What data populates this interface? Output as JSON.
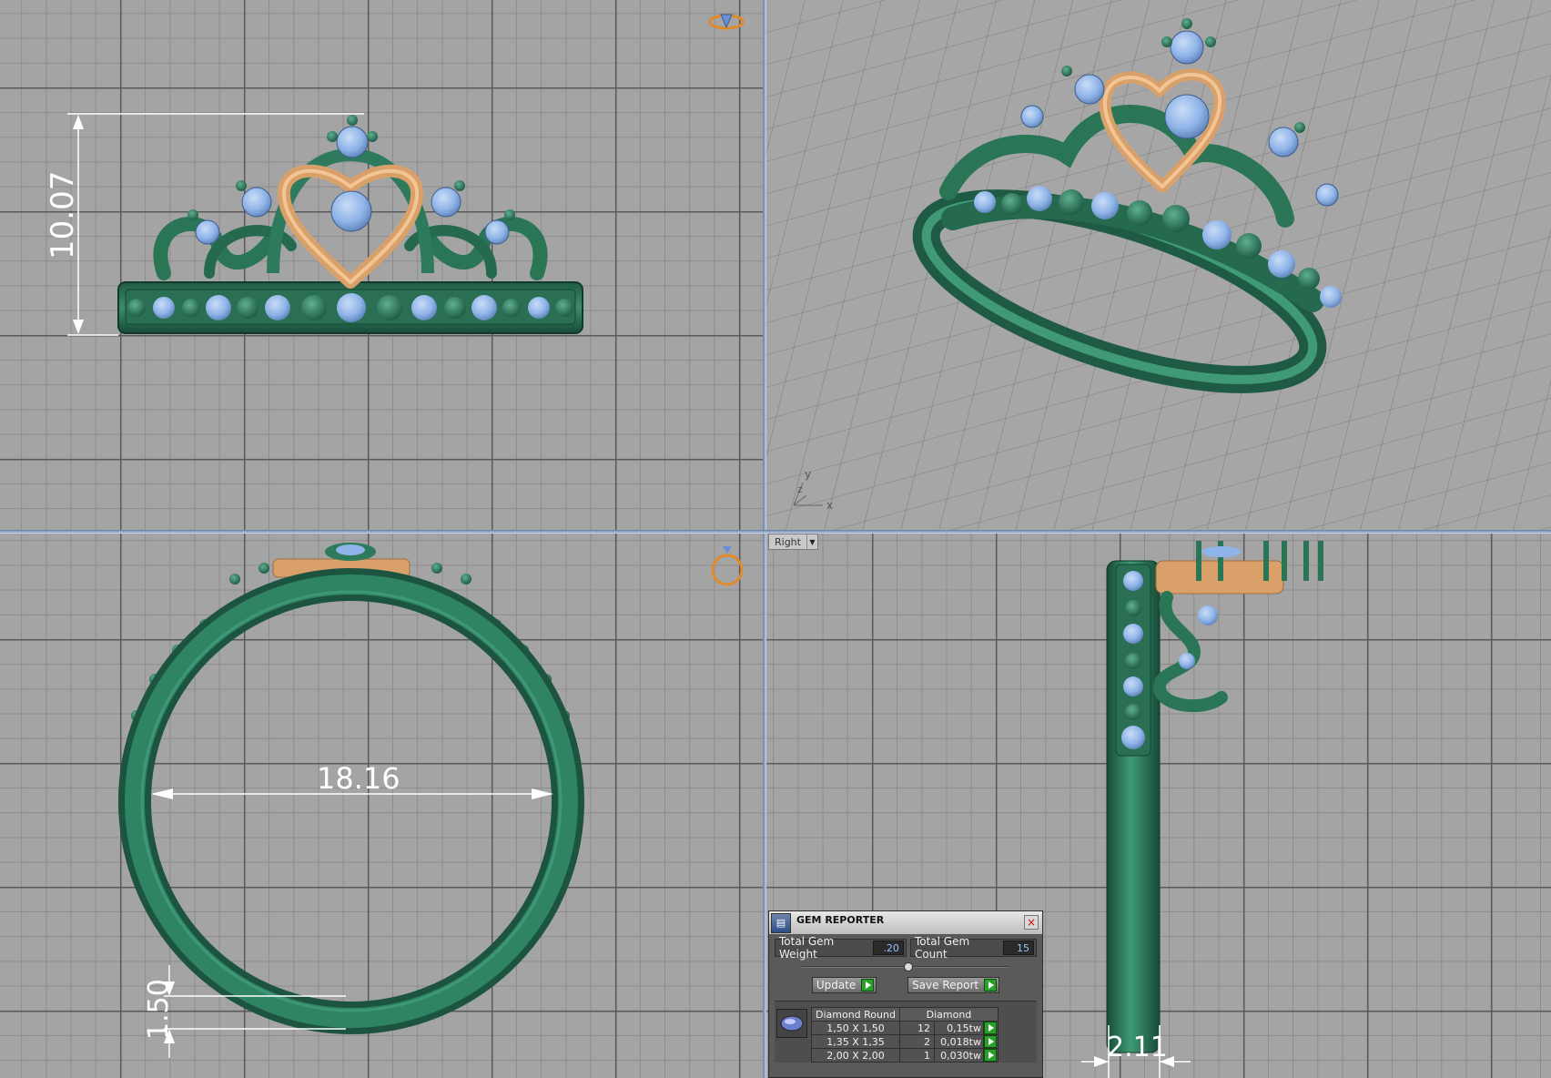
{
  "front_view": {
    "height_dimension": "10.07"
  },
  "top_view": {
    "inner_diameter_dimension": "18.16",
    "band_thickness_dimension": "1.50"
  },
  "right_view": {
    "label": "Right",
    "band_width_dimension": "2.11"
  },
  "perspective_view": {
    "axis_y": "y",
    "axis_z": "z",
    "axis_x": "x"
  },
  "gem_reporter": {
    "title": "GEM REPORTER",
    "total_weight_label": "Total Gem Weight",
    "total_weight_value": ".20",
    "total_count_label": "Total Gem Count",
    "total_count_value": "15",
    "update_label": "Update",
    "save_report_label": "Save Report",
    "columns": [
      "Diamond Round",
      "Diamond"
    ],
    "rows": [
      {
        "size": "1,50 X 1,50",
        "count": "12",
        "weight": "0,15tw"
      },
      {
        "size": "1,35 X 1,35",
        "count": "2",
        "weight": "0,018tw"
      },
      {
        "size": "2,00 X 2,00",
        "count": "1",
        "weight": "0,030tw"
      }
    ]
  },
  "colors": {
    "metal_green": "#2d7a5c",
    "gold": "#d9a06a",
    "gem_blue": "#8fb4e8",
    "grid_background": "#a4a4a4"
  }
}
